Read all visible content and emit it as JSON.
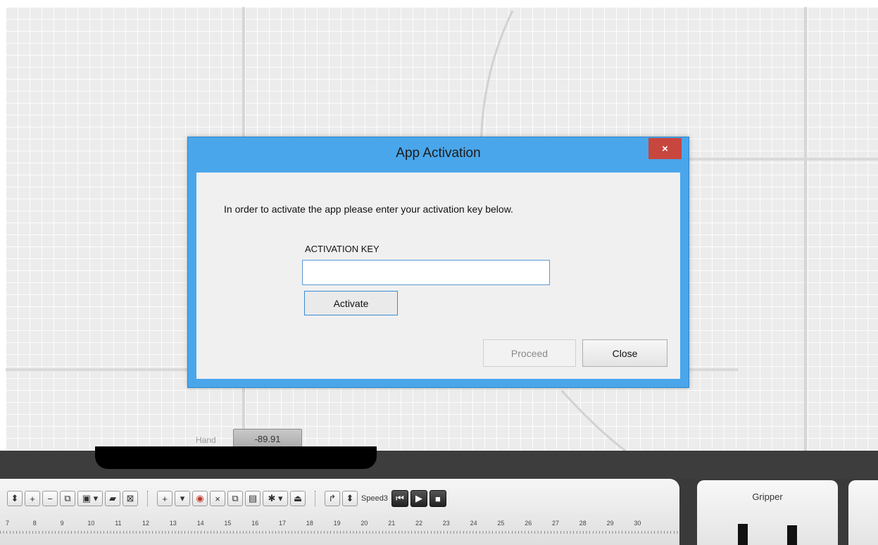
{
  "dialog": {
    "title": "App Activation",
    "close_icon": "×",
    "message": "In order to activate the app please enter your activation key below.",
    "key_label": "ACTIVATION KEY",
    "key_value": "",
    "activate_label": "Activate",
    "proceed_label": "Proceed",
    "close_label": "Close"
  },
  "workspace": {
    "hand_label": "Hand",
    "hand_value": "-89.91"
  },
  "toolbar": {
    "buttons_group1": [
      "⬍",
      "+",
      "−",
      "⧉",
      "💾 ▾",
      "📂",
      "⊠"
    ],
    "buttons_group2": [
      "+",
      "▾",
      "◉",
      "×",
      "⧉",
      "📋",
      "✱ ▾",
      "🔒"
    ],
    "speed_label": "Speed3",
    "ruler_ticks": [
      "7",
      "8",
      "9",
      "10",
      "11",
      "12",
      "13",
      "14",
      "15",
      "16",
      "17",
      "18",
      "19",
      "20",
      "21",
      "22",
      "23",
      "24",
      "25",
      "26",
      "27",
      "28",
      "29",
      "30"
    ]
  },
  "gripper": {
    "title": "Gripper"
  }
}
